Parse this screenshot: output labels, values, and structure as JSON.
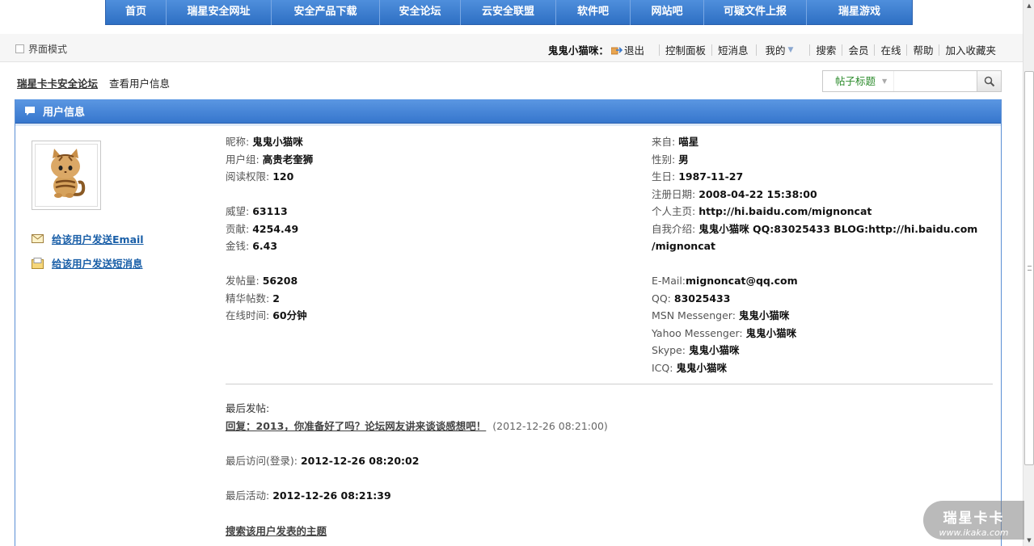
{
  "nav": {
    "items": [
      "首页",
      "瑞星安全网址",
      "安全产品下载",
      "安全论坛",
      "云安全联盟",
      "软件吧",
      "网站吧",
      "可疑文件上报",
      "瑞星游戏"
    ]
  },
  "toolbar": {
    "ui_mode": "界面模式",
    "user_name": "鬼鬼小猫咪：",
    "logout": "退出",
    "control_panel": "控制面板",
    "messages": "短消息",
    "mine": "我的",
    "search": "搜索",
    "members": "会员",
    "online": "在线",
    "help": "帮助",
    "bookmark": "加入收藏夹"
  },
  "breadcrumb": {
    "forum": "瑞星卡卡安全论坛",
    "current": "查看用户信息"
  },
  "search": {
    "type": "帖子标题",
    "placeholder": ""
  },
  "panel": {
    "title": "用户信息"
  },
  "sidebar": {
    "send_email": "给该用户发送Email",
    "send_message": "给该用户发送短消息"
  },
  "profile_left": {
    "nickname_label": "昵称:",
    "nickname": "鬼鬼小猫咪",
    "group_label": "用户组:",
    "group": "高贵老奎狮",
    "read_perm_label": "阅读权限:",
    "read_perm": "120",
    "prestige_label": "威望:",
    "prestige": "63113",
    "contribution_label": "贡献:",
    "contribution": "4254.49",
    "money_label": "金钱:",
    "money": "6.43",
    "posts_label": "发帖量:",
    "posts": "56208",
    "digest_label": "精华帖数:",
    "digest": "2",
    "online_time_label": "在线时间:",
    "online_time": "60分钟"
  },
  "profile_right": {
    "from_label": "来自:",
    "from": "喵星",
    "gender_label": "性别:",
    "gender": "男",
    "birthday_label": "生日:",
    "birthday": "1987-11-27",
    "register_label": "注册日期:",
    "register": "2008-04-22 15:38:00",
    "homepage_label": "个人主页:",
    "homepage": "http://hi.baidu.com/mignoncat",
    "intro_label": "自我介绍:",
    "intro_line1": "鬼鬼小猫咪 QQ:83025433 BLOG:http://hi.baidu.com",
    "intro_line2": "/mignoncat",
    "email_label": "E-Mail:",
    "email": "mignoncat@qq.com",
    "qq_label": "QQ:",
    "qq": "83025433",
    "msn_label": "MSN Messenger:",
    "msn": "鬼鬼小猫咪",
    "yahoo_label": "Yahoo Messenger:",
    "yahoo": "鬼鬼小猫咪",
    "skype_label": "Skype:",
    "skype": "鬼鬼小猫咪",
    "icq_label": "ICQ:",
    "icq": "鬼鬼小猫咪"
  },
  "activity": {
    "last_post_label": "最后发帖:",
    "last_post_title": "回复：2013，你准备好了吗？论坛网友讲来谈谈感想吧！",
    "last_post_date": "(2012-12-26 08:21:00)",
    "last_visit_label": "最后访问(登录):",
    "last_visit": "2012-12-26 08:20:02",
    "last_active_label": "最后活动:",
    "last_active": "2012-12-26 08:21:39",
    "search_posts": "搜索该用户发表的主题"
  },
  "watermark": {
    "title": "瑞星卡卡",
    "url": "www.ikaka.com"
  },
  "colors": {
    "nav_blue": "#3a7dd2",
    "link_blue": "#1a5fa8",
    "search_type_green": "#2a8a2a"
  }
}
